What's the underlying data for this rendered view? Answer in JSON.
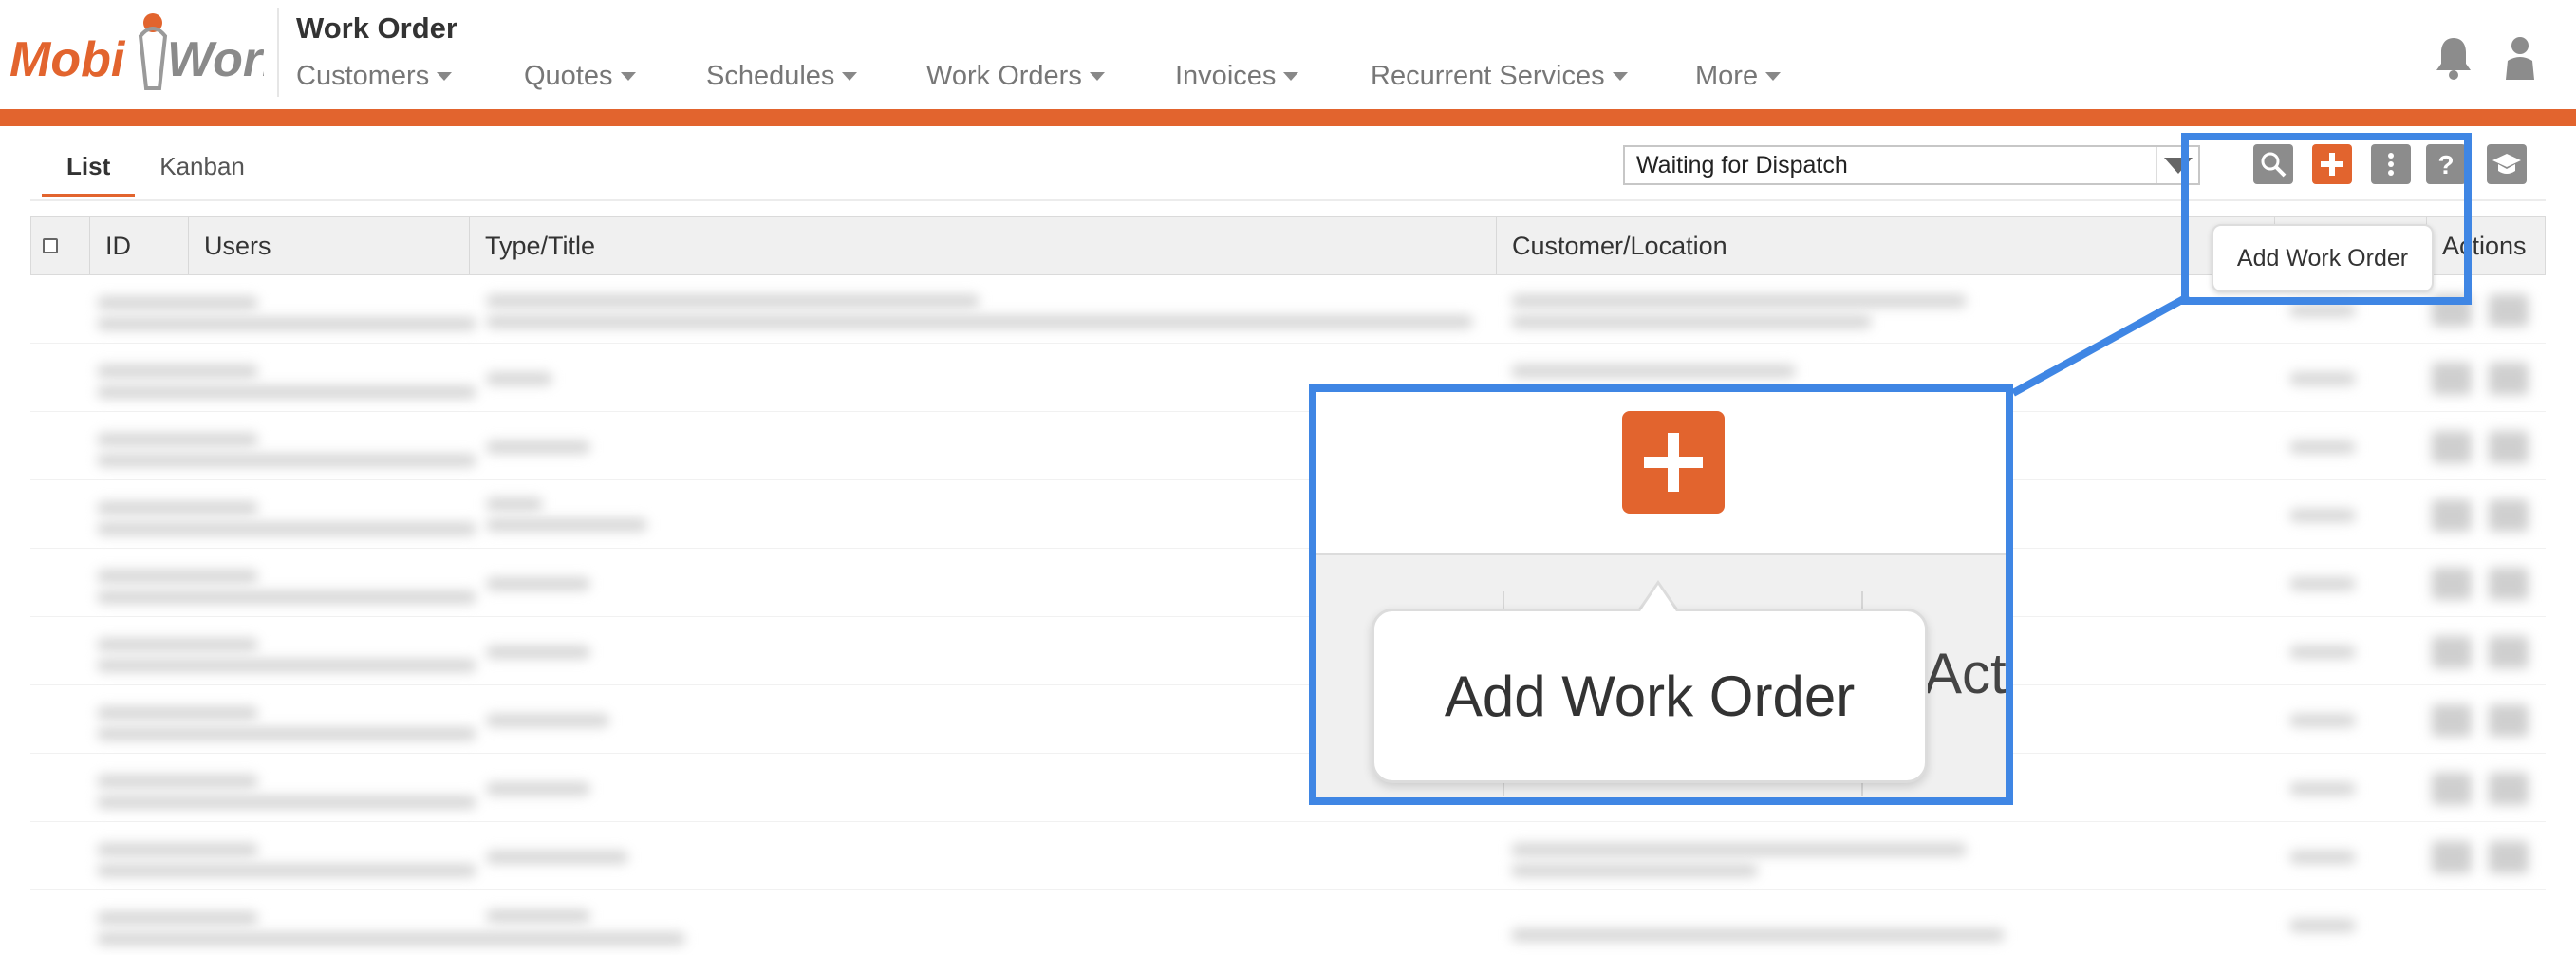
{
  "header": {
    "logo_text": "MobiWork",
    "title": "Work Order",
    "nav": [
      {
        "label": "Customers"
      },
      {
        "label": "Quotes"
      },
      {
        "label": "Schedules"
      },
      {
        "label": "Work Orders"
      },
      {
        "label": "Invoices"
      },
      {
        "label": "Recurrent Services"
      },
      {
        "label": "More"
      }
    ],
    "icons": [
      "bell-icon",
      "user-icon"
    ]
  },
  "toolbar": {
    "tabs": [
      {
        "label": "List",
        "active": true
      },
      {
        "label": "Kanban",
        "active": false
      }
    ],
    "filter_value": "Waiting for Dispatch",
    "buttons": [
      "search-icon",
      "plus-icon",
      "more-vertical-icon",
      "help-icon",
      "graduation-cap-icon"
    ],
    "tooltip": "Add Work Order"
  },
  "table": {
    "columns": [
      "ID",
      "Users",
      "Type/Title",
      "Customer/Location",
      "Actions"
    ]
  },
  "zoom": {
    "tooltip": "Add Work Order",
    "partial_header": "Acti"
  },
  "colors": {
    "accent": "#e2642e",
    "highlight": "#3f86e4"
  }
}
